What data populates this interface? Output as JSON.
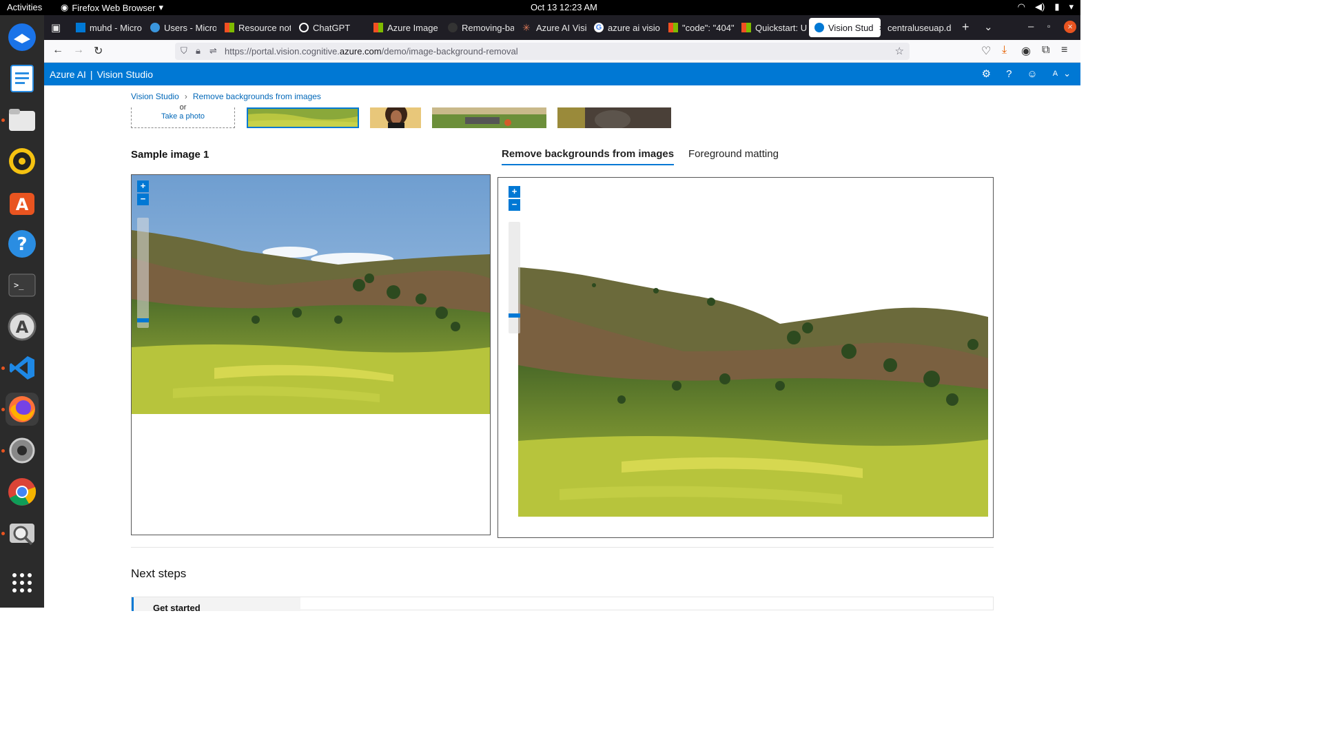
{
  "topbar": {
    "activities": "Activities",
    "app_name": "Firefox Web Browser",
    "clock": "Oct 13  12:23 AM"
  },
  "dock": {
    "items": [
      "thunderbird-icon",
      "libreoffice-writer-icon",
      "files-icon",
      "rhythmbox-icon",
      "app-center-icon",
      "help-icon",
      "terminal-icon",
      "software-updater-icon",
      "vscode-icon",
      "firefox-icon",
      "settings-icon",
      "chrome-icon",
      "screenshot-icon",
      "show-apps-icon"
    ]
  },
  "browser": {
    "tabs": [
      {
        "label": "muhd - Micro",
        "color": "#0078d4"
      },
      {
        "label": "Users - Micro",
        "color": "#3a96dd"
      },
      {
        "label": "Resource not",
        "color": "#f25022"
      },
      {
        "label": "ChatGPT",
        "color": "#ffffff"
      },
      {
        "label": "Azure Image",
        "color": "#f25022"
      },
      {
        "label": "Removing-ba",
        "color": "#333333"
      },
      {
        "label": "Azure AI Visi",
        "color": "#d97757"
      },
      {
        "label": "azure ai visio",
        "color": "#4285f4"
      },
      {
        "label": "\"code\": \"404\"",
        "color": "#f25022"
      },
      {
        "label": "Quickstart: U",
        "color": "#f25022"
      },
      {
        "label": "Vision Stud",
        "color": "#0078d4"
      },
      {
        "label": "centraluseuap.d",
        "color": "#888888"
      }
    ],
    "url_prefix": "https://portal.vision.cognitive.",
    "url_domain": "azure.com",
    "url_path": "/demo/image-background-removal"
  },
  "azure_header": {
    "brand": "Azure AI",
    "separator": "|",
    "product": "Vision Studio",
    "avatar_letter": "A"
  },
  "breadcrumb": {
    "home": "Vision Studio",
    "separator": "›",
    "current": "Remove backgrounds from images"
  },
  "upload": {
    "or_text": "or",
    "take_photo": "Take a photo"
  },
  "sample": {
    "title": "Sample image 1"
  },
  "result_tabs": {
    "active": "Remove backgrounds from images",
    "other": "Foreground matting"
  },
  "zoom": {
    "plus": "+",
    "minus": "−",
    "left_level": 0.05,
    "right_level": 0.15
  },
  "next_steps": {
    "title": "Next steps",
    "card_title": "Get started"
  }
}
